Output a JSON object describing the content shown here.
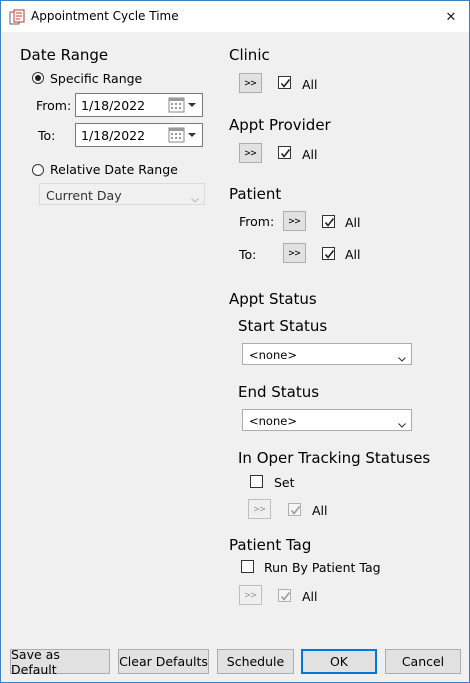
{
  "window": {
    "title": "Appointment Cycle Time",
    "close_glyph": "✕"
  },
  "date_range": {
    "heading": "Date Range",
    "specific_label": "Specific Range",
    "from_label": "From:",
    "from_value": "1/18/2022",
    "to_label": "To:",
    "to_value": "1/18/2022",
    "relative_label": "Relative Date Range",
    "relative_value": "Current Day"
  },
  "clinic": {
    "heading": "Clinic",
    "picker": ">>",
    "all_label": "All"
  },
  "appt_provider": {
    "heading": "Appt Provider",
    "picker": ">>",
    "all_label": "All"
  },
  "patient": {
    "heading": "Patient",
    "from_label": "From:",
    "from_picker": ">>",
    "from_all_label": "All",
    "to_label": "To:",
    "to_picker": ">>",
    "to_all_label": "All"
  },
  "appt_status": {
    "heading": "Appt Status",
    "start_label": "Start Status",
    "start_value": "<none>",
    "end_label": "End Status",
    "end_value": "<none>",
    "in_oper_label": "In Oper Tracking Statuses",
    "set_label": "Set",
    "picker": ">>",
    "all_label": "All"
  },
  "patient_tag": {
    "heading": "Patient Tag",
    "run_by_label": "Run By Patient Tag",
    "picker": ">>",
    "all_label": "All"
  },
  "footer": {
    "save_default": "Save as Default",
    "clear_defaults": "Clear Defaults",
    "schedule": "Schedule",
    "ok": "OK",
    "cancel": "Cancel"
  },
  "colors": {
    "window_border": "#3c80c8",
    "focus_blue": "#0078d7",
    "face": "#f0f0f0"
  }
}
